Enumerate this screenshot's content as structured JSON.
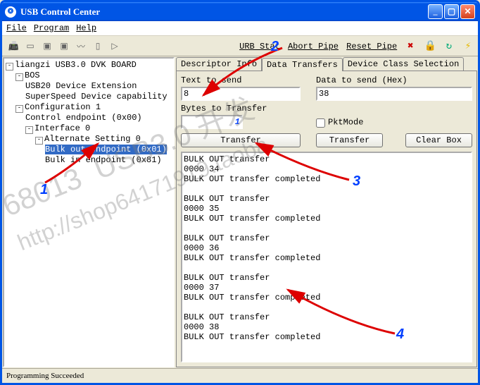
{
  "window": {
    "title": "USB Control Center"
  },
  "menu": {
    "file": "File",
    "program": "Program",
    "help": "Help"
  },
  "toolbar": {
    "links": {
      "urb_stat": "URB Stat",
      "abort_pipe": "Abort Pipe",
      "reset_pipe": "Reset Pipe"
    }
  },
  "tree": [
    {
      "expand": "-",
      "label": "liangzi USB3.0 DVK BOARD",
      "children": [
        {
          "expand": "-",
          "label": "BOS",
          "children": [
            {
              "label": "USB20 Device Extension"
            },
            {
              "label": "SuperSpeed Device capability"
            }
          ]
        },
        {
          "expand": "-",
          "label": "Configuration 1",
          "children": [
            {
              "label": "Control endpoint (0x00)"
            },
            {
              "expand": "-",
              "label": "Interface 0",
              "children": [
                {
                  "expand": "-",
                  "label": "Alternate Setting 0",
                  "children": [
                    {
                      "label": "Bulk out endpoint (0x01)",
                      "selected": true
                    },
                    {
                      "label": "Bulk in endpoint (0x81)"
                    }
                  ]
                }
              ]
            }
          ]
        }
      ]
    }
  ],
  "tabs": {
    "descriptor": "Descriptor Info",
    "data": "Data Transfers",
    "device_class": "Device Class Selection",
    "active": "data"
  },
  "transfer": {
    "text_label": "Text to send",
    "text_value": "8",
    "hex_label": "Data to send (Hex)",
    "hex_value": "38",
    "bytes_label": "Bytes to Transfer",
    "bytes_value": "1",
    "pktmode_label": "PktMode",
    "btn_transfer_left": "Transfer",
    "btn_transfer_right": "Transfer",
    "btn_clear": "Clear Box"
  },
  "log": "BULK OUT transfer\n0000 34\nBULK OUT transfer completed\n\nBULK OUT transfer\n0000 35\nBULK OUT transfer completed\n\nBULK OUT transfer\n0000 36\nBULK OUT transfer completed\n\nBULK OUT transfer\n0000 37\nBULK OUT transfer completed\n\nBULK OUT transfer\n0000 38\nBULK OUT transfer completed",
  "status": "Programming Succeeded",
  "annotations": {
    "n1": "1",
    "n2": "2",
    "n3": "3",
    "n4": "4"
  },
  "watermark": "68013  USB3.0 开发\nhttp://shop64171919.taoba"
}
